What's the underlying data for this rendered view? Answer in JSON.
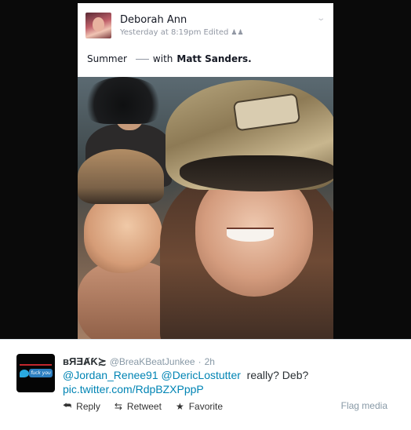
{
  "facebook_post": {
    "author": "Deborah Ann",
    "timestamp": "Yesterday at 8:19pm",
    "edited_label": "Edited",
    "status_text": "Summer",
    "with_label": "with",
    "tagged_person": "Matt Sanders",
    "tag_suffix": ".",
    "icons": {
      "audience": "friends-icon",
      "options": "chevron-down-icon"
    }
  },
  "tweet": {
    "display_name": "ʙЯƎȺƘ≿",
    "handle": "@BreaKBeatJunkee",
    "separator": "·",
    "time": "2h",
    "mention_1": "@Jordan_Renee91",
    "mention_2": "@DericLostutter",
    "body_text": "really? Deb?",
    "pic_link": "pic.twitter.com/RdpBZXPppP",
    "avatar_badge_text": "fuck you",
    "actions": {
      "reply": "Reply",
      "retweet": "Retweet",
      "favorite": "Favorite"
    },
    "flag_label": "Flag media",
    "icons": {
      "reply": "reply-icon",
      "retweet": "retweet-icon",
      "favorite": "star-icon"
    },
    "colors": {
      "link": "#0084b4",
      "muted": "#8899a6"
    }
  }
}
